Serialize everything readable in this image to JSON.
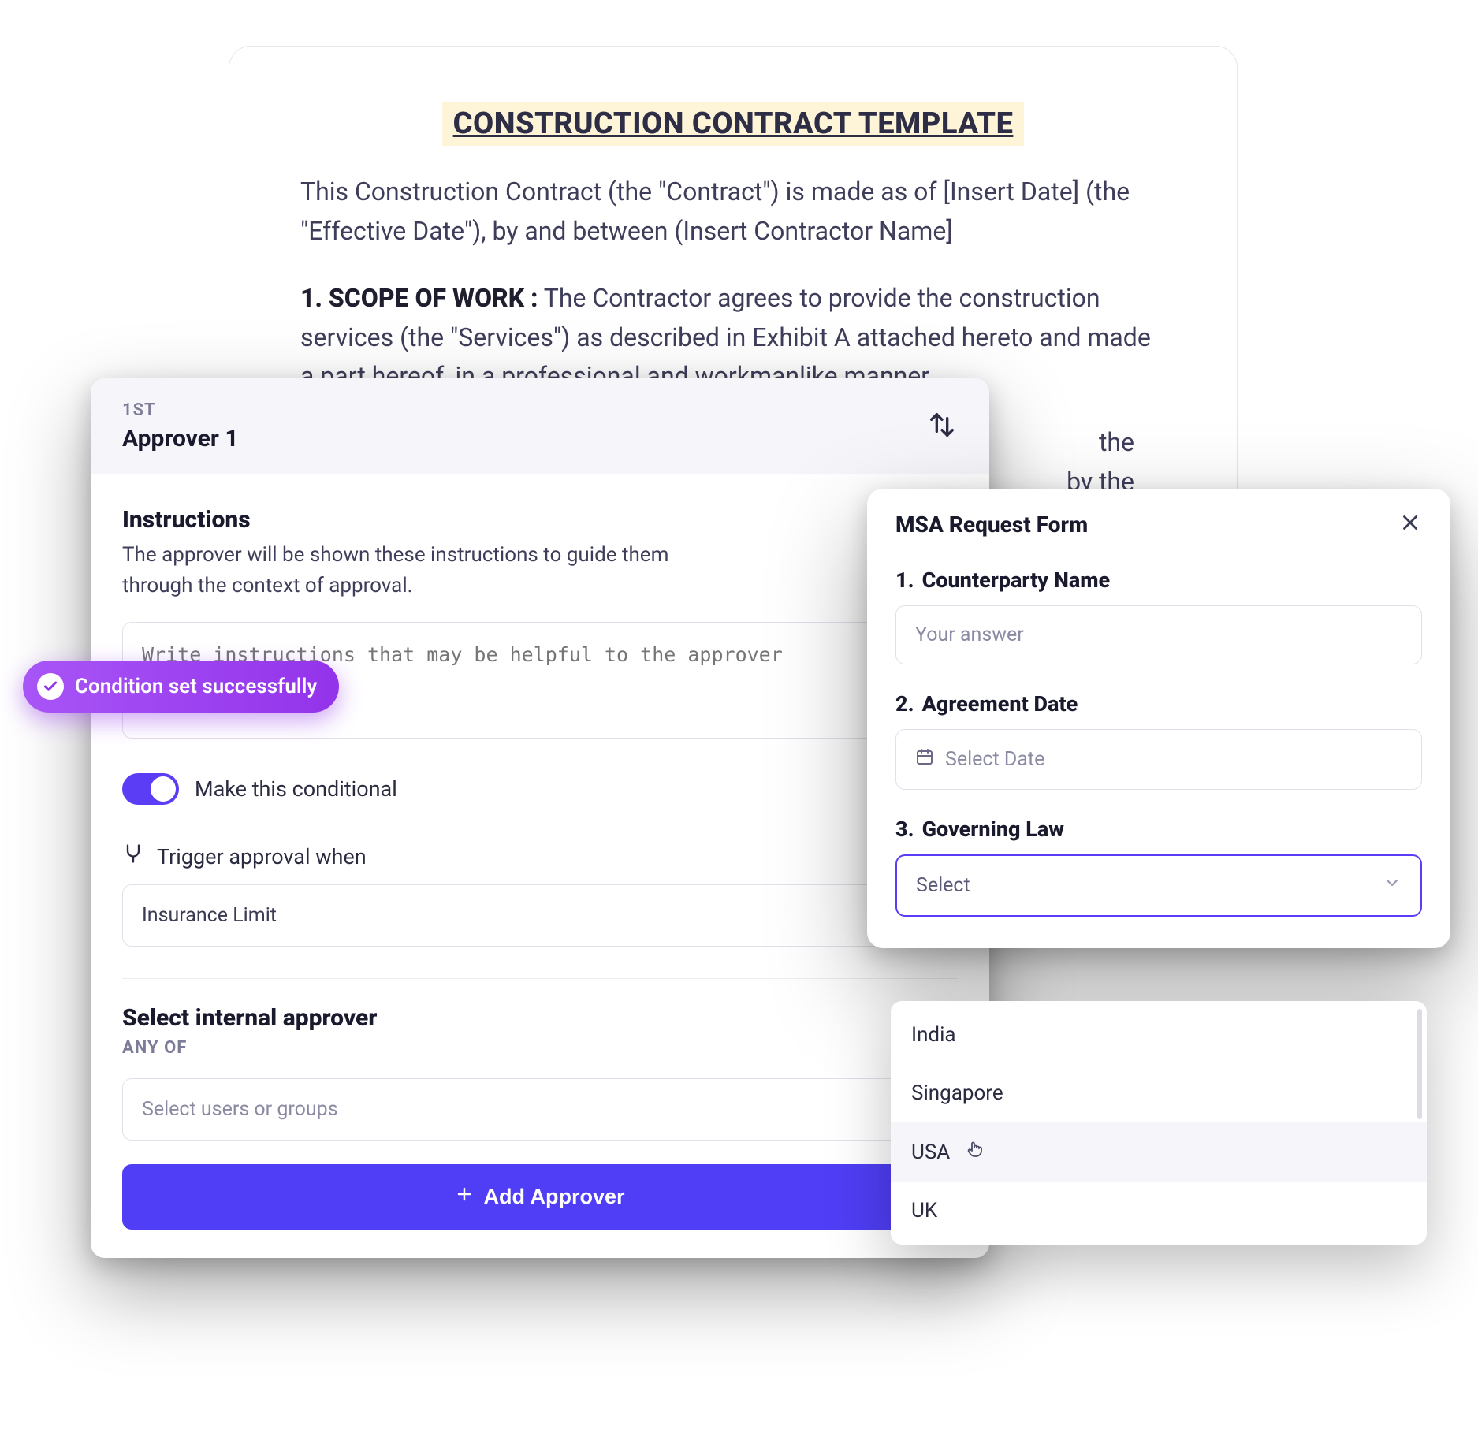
{
  "document": {
    "title": "CONSTRUCTION CONTRACT TEMPLATE",
    "intro": "This Construction Contract (the \"Contract\") is made as of [Insert Date] (the \"Effective Date\"), by and between (Insert Contractor Name]",
    "section1_label": "1. SCOPE OF WORK :",
    "section1_body": " The Contractor agrees to provide the construction services (the \"Services\") as described in Exhibit A attached hereto and made a part hereof, in a professional and workmanlike manner.",
    "section2_fragment_a": "the",
    "section2_fragment_b": "by the"
  },
  "approver": {
    "ordinal": "1ST",
    "name": "Approver 1",
    "instructions_title": "Instructions",
    "instructions_desc": "The approver will be shown these instructions to guide them through the context of approval.",
    "instructions_placeholder": "Write instructions that may be helpful to the approver",
    "success_message": "Condition set successfully",
    "conditional_label": "Make this conditional",
    "conditional_on": true,
    "trigger_label": "Trigger approval when",
    "trigger_value": "Insurance Limit",
    "internal_title": "Select internal approver",
    "anyof_label": "ANY OF",
    "users_placeholder": "Select users or groups",
    "add_button": "Add Approver"
  },
  "msa": {
    "title": "MSA Request Form",
    "fields": {
      "counterparty": {
        "num": "1.",
        "label": "Counterparty Name",
        "placeholder": "Your answer"
      },
      "agreement_date": {
        "num": "2.",
        "label": "Agreement Date",
        "placeholder": "Select Date"
      },
      "governing_law": {
        "num": "3.",
        "label": "Governing Law",
        "placeholder": "Select"
      }
    },
    "options": [
      "India",
      "Singapore",
      "USA",
      "UK"
    ],
    "hover_index": 2
  }
}
